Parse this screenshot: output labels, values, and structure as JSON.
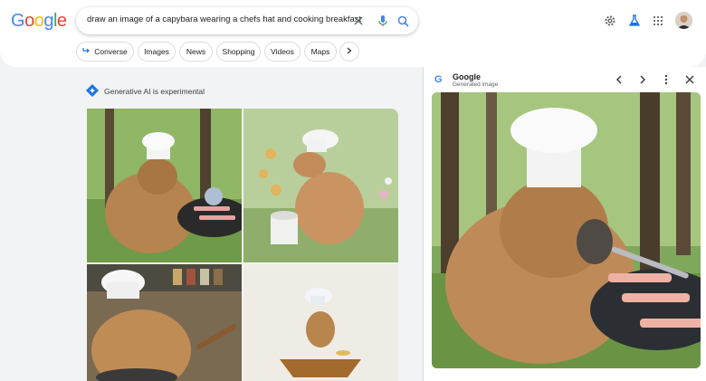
{
  "header": {
    "logo": [
      "G",
      "o",
      "o",
      "g",
      "l",
      "e"
    ],
    "logo_colors": [
      "#4285F4",
      "#EA4335",
      "#FBBC05",
      "#4285F4",
      "#34A853",
      "#EA4335"
    ],
    "search_query": "draw an image of a capybara wearing a chefs hat and cooking breakfast"
  },
  "chips": [
    {
      "label": "Converse",
      "icon": "converse-arrow-icon"
    },
    {
      "label": "Images"
    },
    {
      "label": "News"
    },
    {
      "label": "Shopping"
    },
    {
      "label": "Videos"
    },
    {
      "label": "Maps"
    }
  ],
  "ai_notice": "Generative AI is experimental",
  "panel": {
    "title": "Google",
    "subtitle": "Generated image"
  },
  "colors": {
    "accent_blue": "#1a73e8",
    "chip_border": "#dadce0",
    "page_bg": "#f1f3f4"
  },
  "icons": [
    "close-icon",
    "mic-icon",
    "search-icon",
    "settings-icon",
    "labs-icon",
    "apps-grid-icon",
    "avatar",
    "gemini-diamond-icon",
    "chevron-left-icon",
    "chevron-right-icon",
    "more-vert-icon"
  ]
}
